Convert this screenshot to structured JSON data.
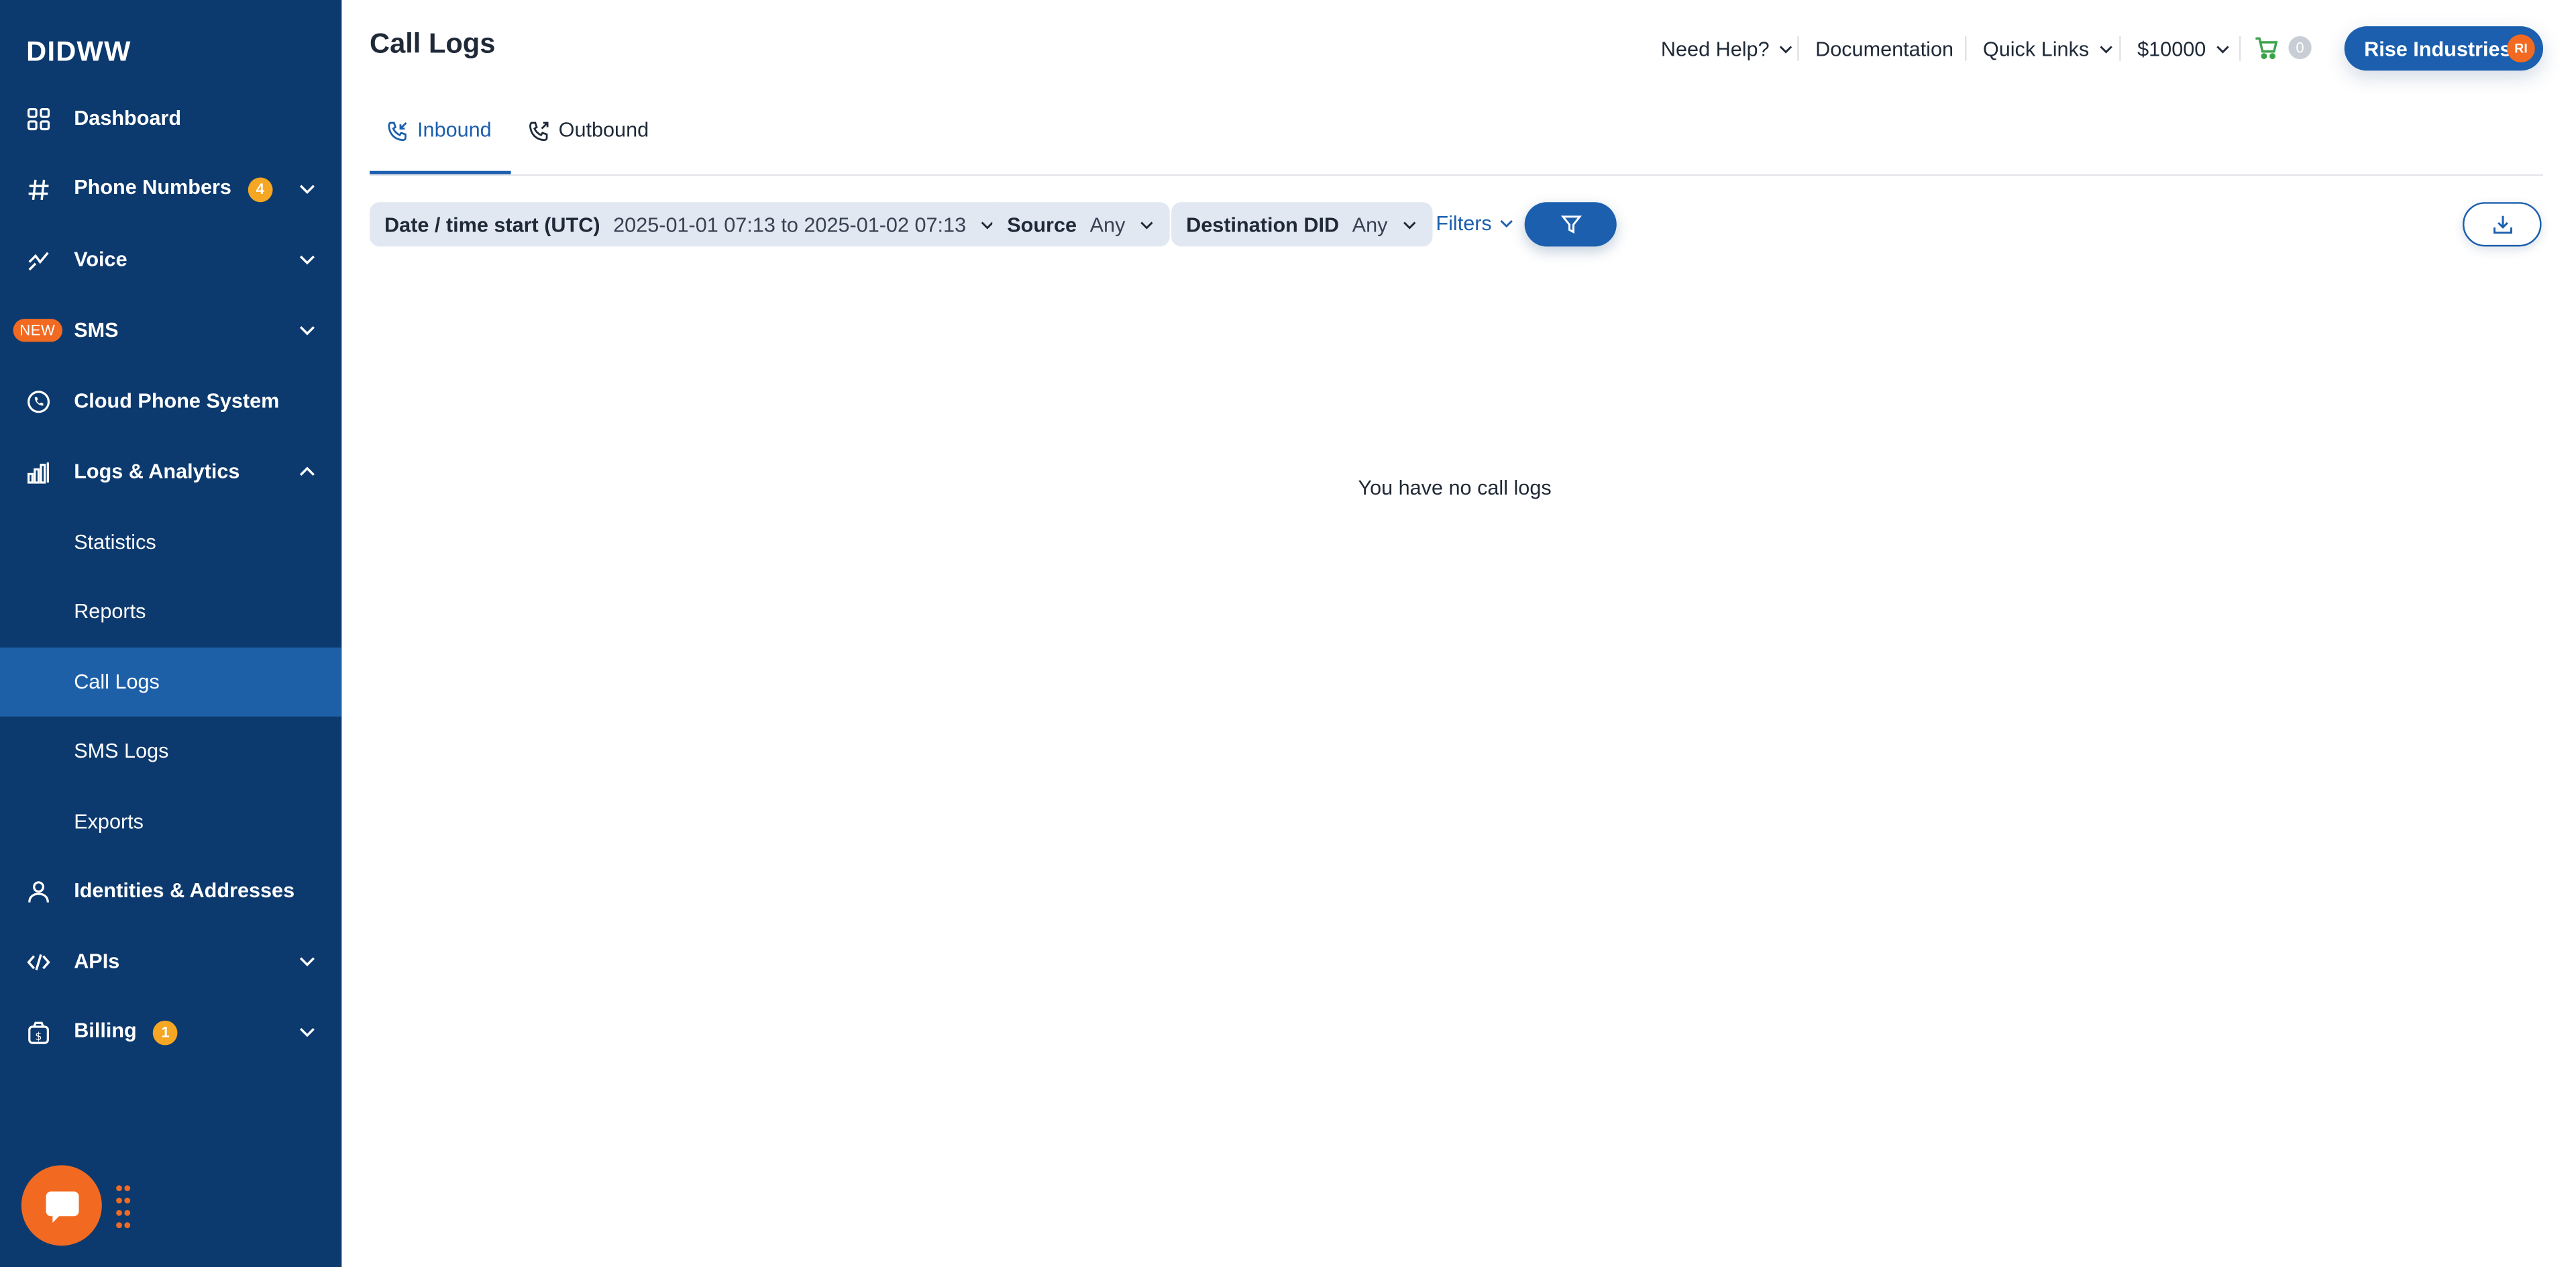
{
  "brand": {
    "logo": "DIDWW"
  },
  "sidebar": {
    "items": [
      {
        "label": "Dashboard",
        "icon": "grid-icon"
      },
      {
        "label": "Phone Numbers",
        "icon": "hash-icon",
        "badge": "4"
      },
      {
        "label": "Voice",
        "icon": "voice-icon"
      },
      {
        "label": "SMS",
        "icon": "sms-icon",
        "new_badge": "NEW"
      },
      {
        "label": "Cloud Phone System",
        "icon": "cloud-phone-icon"
      },
      {
        "label": "Logs & Analytics",
        "icon": "bar-chart-icon"
      },
      {
        "label": "Identities & Addresses",
        "icon": "user-icon"
      },
      {
        "label": "APIs",
        "icon": "code-icon"
      },
      {
        "label": "Billing",
        "icon": "billing-icon",
        "badge": "1"
      }
    ],
    "logs_subitems": [
      {
        "label": "Statistics"
      },
      {
        "label": "Reports"
      },
      {
        "label": "Call Logs",
        "active": true
      },
      {
        "label": "SMS Logs"
      },
      {
        "label": "Exports"
      }
    ]
  },
  "header": {
    "title": "Call Logs",
    "need_help": "Need Help?",
    "documentation": "Documentation",
    "quick_links": "Quick Links",
    "balance": "$10000",
    "cart_count": "0",
    "account_name": "Rise Industries",
    "account_initials": "RI"
  },
  "tabs": [
    {
      "label": "Inbound",
      "active": true
    },
    {
      "label": "Outbound",
      "active": false
    }
  ],
  "filters": {
    "date_label": "Date / time start (UTC)",
    "date_value": "2025-01-01 07:13 to 2025-01-02 07:13",
    "source_label": "Source",
    "source_value": "Any",
    "destination_label": "Destination DID",
    "destination_value": "Any",
    "filters_link": "Filters"
  },
  "empty_state": "You have no call logs",
  "colors": {
    "sidebar_bg": "#0d3a6e",
    "sidebar_active": "#1d60a8",
    "accent": "#1b5fae",
    "orange": "#f26a21",
    "badge": "#f5a623",
    "cart_green": "#3aa34a"
  }
}
